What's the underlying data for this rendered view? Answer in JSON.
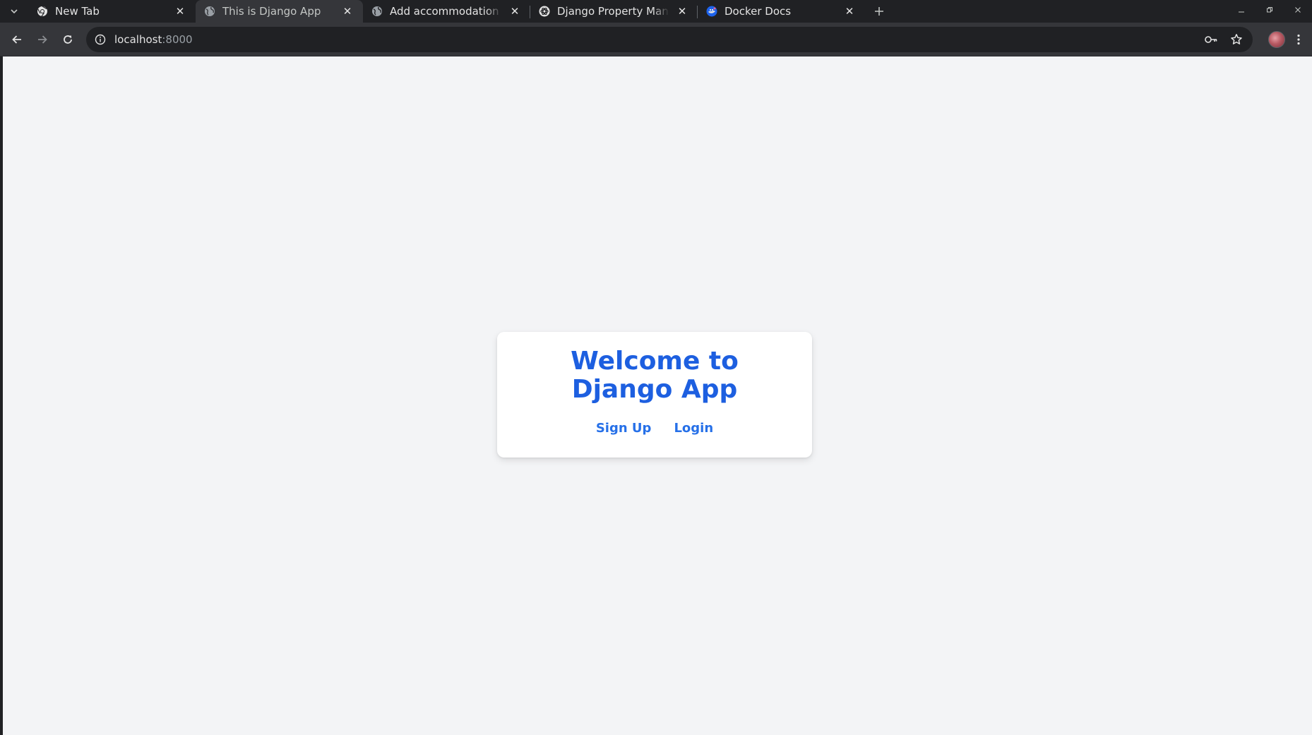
{
  "tabs": [
    {
      "title": "New Tab",
      "favicon": "chrome-icon",
      "active": false
    },
    {
      "title": "This is Django App",
      "favicon": "globe-icon",
      "active": true
    },
    {
      "title": "Add accommodation | Dj",
      "favicon": "globe-icon",
      "active": false
    },
    {
      "title": "Django Property Manage",
      "favicon": "openai-icon",
      "active": false
    },
    {
      "title": "Docker Docs",
      "favicon": "docker-icon",
      "active": false
    }
  ],
  "address_bar": {
    "host": "localhost",
    "port": ":8000"
  },
  "page": {
    "title": "Welcome to Django App",
    "signup_label": "Sign Up",
    "login_label": "Login"
  },
  "colors": {
    "title": "#1d5fe0",
    "link": "#2670e8",
    "page_bg": "#f3f4f6",
    "card_bg": "#ffffff",
    "chrome_dark": "#202124",
    "chrome_toolbar": "#35363a"
  }
}
